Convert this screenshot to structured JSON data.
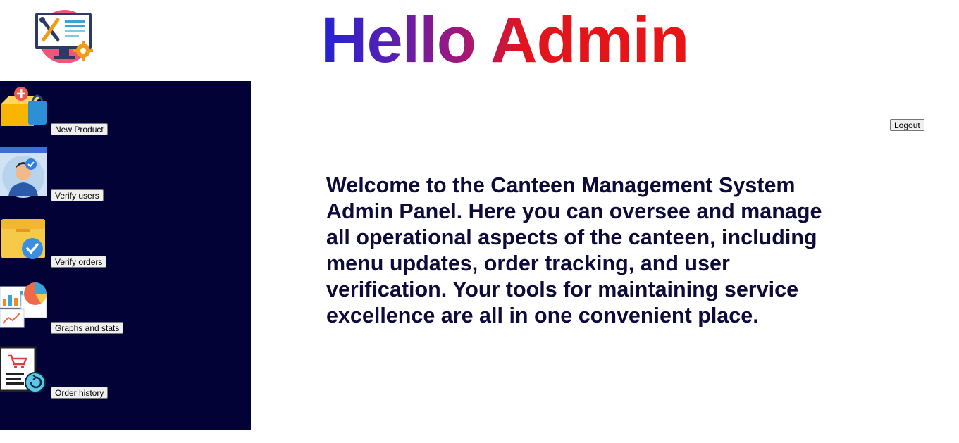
{
  "header": {
    "title": "Hello Admin",
    "logo_icon": "admin-tools-monitor-icon"
  },
  "sidebar": {
    "items": [
      {
        "label": "New Product",
        "icon": "new-product-box-icon"
      },
      {
        "label": "Verify users",
        "icon": "verify-user-icon"
      },
      {
        "label": "Verify orders",
        "icon": "verify-order-box-icon"
      },
      {
        "label": "Graphs and stats",
        "icon": "graphs-stats-icon"
      },
      {
        "label": "Order history",
        "icon": "order-history-icon"
      }
    ],
    "background": "#020236"
  },
  "toolbar": {
    "logout_label": "Logout"
  },
  "main": {
    "welcome_text": "Welcome to the Canteen Management System Admin Panel. Here you can oversee and manage all operational aspects of the canteen, including menu updates, order tracking, and user verification. Your tools for maintaining service excellence are all in one convenient place."
  },
  "colors": {
    "title_gradient_start": "#2323d6",
    "title_gradient_end": "#e81515",
    "welcome_text": "#0d0b3a"
  }
}
